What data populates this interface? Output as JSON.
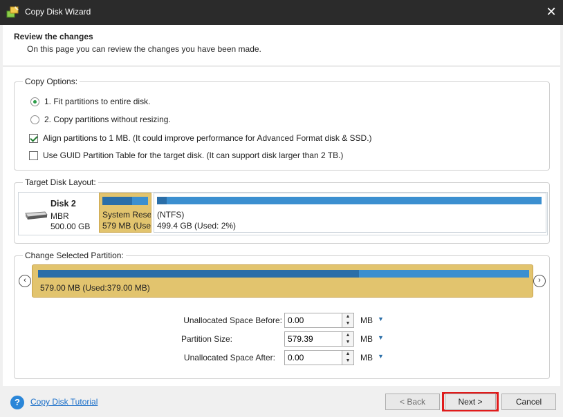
{
  "window": {
    "title": "Copy Disk Wizard",
    "close_glyph": "✕"
  },
  "header": {
    "title": "Review the changes",
    "subtitle": "On this page you can review the changes you have been made."
  },
  "copy_options": {
    "legend": "Copy Options:",
    "opt1": "1. Fit partitions to entire disk.",
    "opt1_selected": true,
    "opt2": "2. Copy partitions without resizing.",
    "opt2_selected": false,
    "align": "Align partitions to 1 MB.  (It could improve performance for Advanced Format disk & SSD.)",
    "align_checked": true,
    "gpt": "Use GUID Partition Table for the target disk. (It can support disk larger than 2 TB.)",
    "gpt_checked": false
  },
  "target_layout": {
    "legend": "Target Disk Layout:",
    "disk_name": "Disk 2",
    "disk_type": "MBR",
    "disk_size": "500.00 GB",
    "partitions": [
      {
        "label": "System Rese",
        "size": "579 MB (Use",
        "used_fraction": 0.65
      },
      {
        "label": "(NTFS)",
        "size": "499.4 GB (Used: 2%)",
        "used_fraction": 0.02
      }
    ]
  },
  "change_partition": {
    "legend": "Change Selected Partition:",
    "label": "579.00 MB (Used:379.00 MB)",
    "used_fraction": 0.654,
    "left_arrow": "‹",
    "right_arrow": "›",
    "fields": [
      {
        "label": "Unallocated Space Before:",
        "value": "0.00",
        "unit": "MB"
      },
      {
        "label": "Partition Size:",
        "value": "579.39",
        "unit": "MB"
      },
      {
        "label": "Unallocated Space After:",
        "value": "0.00",
        "unit": "MB"
      }
    ],
    "dropdown_glyph": "▼",
    "spin_up": "▲",
    "spin_down": "▼"
  },
  "footer": {
    "help_glyph": "?",
    "tutorial": "Copy Disk Tutorial",
    "back": "< Back",
    "next": "Next >",
    "cancel": "Cancel"
  },
  "colors": {
    "titlebar": "#2b2b2b",
    "partition_selected": "#e2c46e",
    "bar": "#3b8fd0",
    "bar_used": "#2a6ea8",
    "highlight": "#e01b1b"
  }
}
